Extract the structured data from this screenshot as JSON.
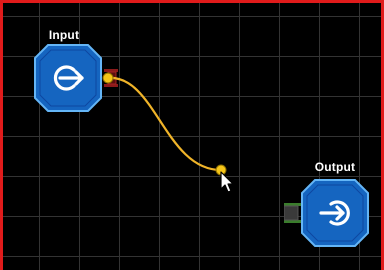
{
  "canvas": {
    "grid": true,
    "border_color": "#e01b1b",
    "grid_color": "#333333",
    "background": "#000000"
  },
  "nodes": [
    {
      "label": "Input",
      "icon": "sign-out-arrow-icon",
      "color": "#1565c0",
      "port": "output-port",
      "port_color": "#8b1a1a"
    },
    {
      "label": "Output",
      "icon": "sign-in-arrow-icon",
      "color": "#1565c0",
      "port": "input-port",
      "port_color": "#3a7d2c"
    }
  ],
  "wire": {
    "color": "#f0b429",
    "state": "dragging",
    "connected": false
  },
  "cursor": {
    "icon": "arrow-cursor-icon"
  }
}
